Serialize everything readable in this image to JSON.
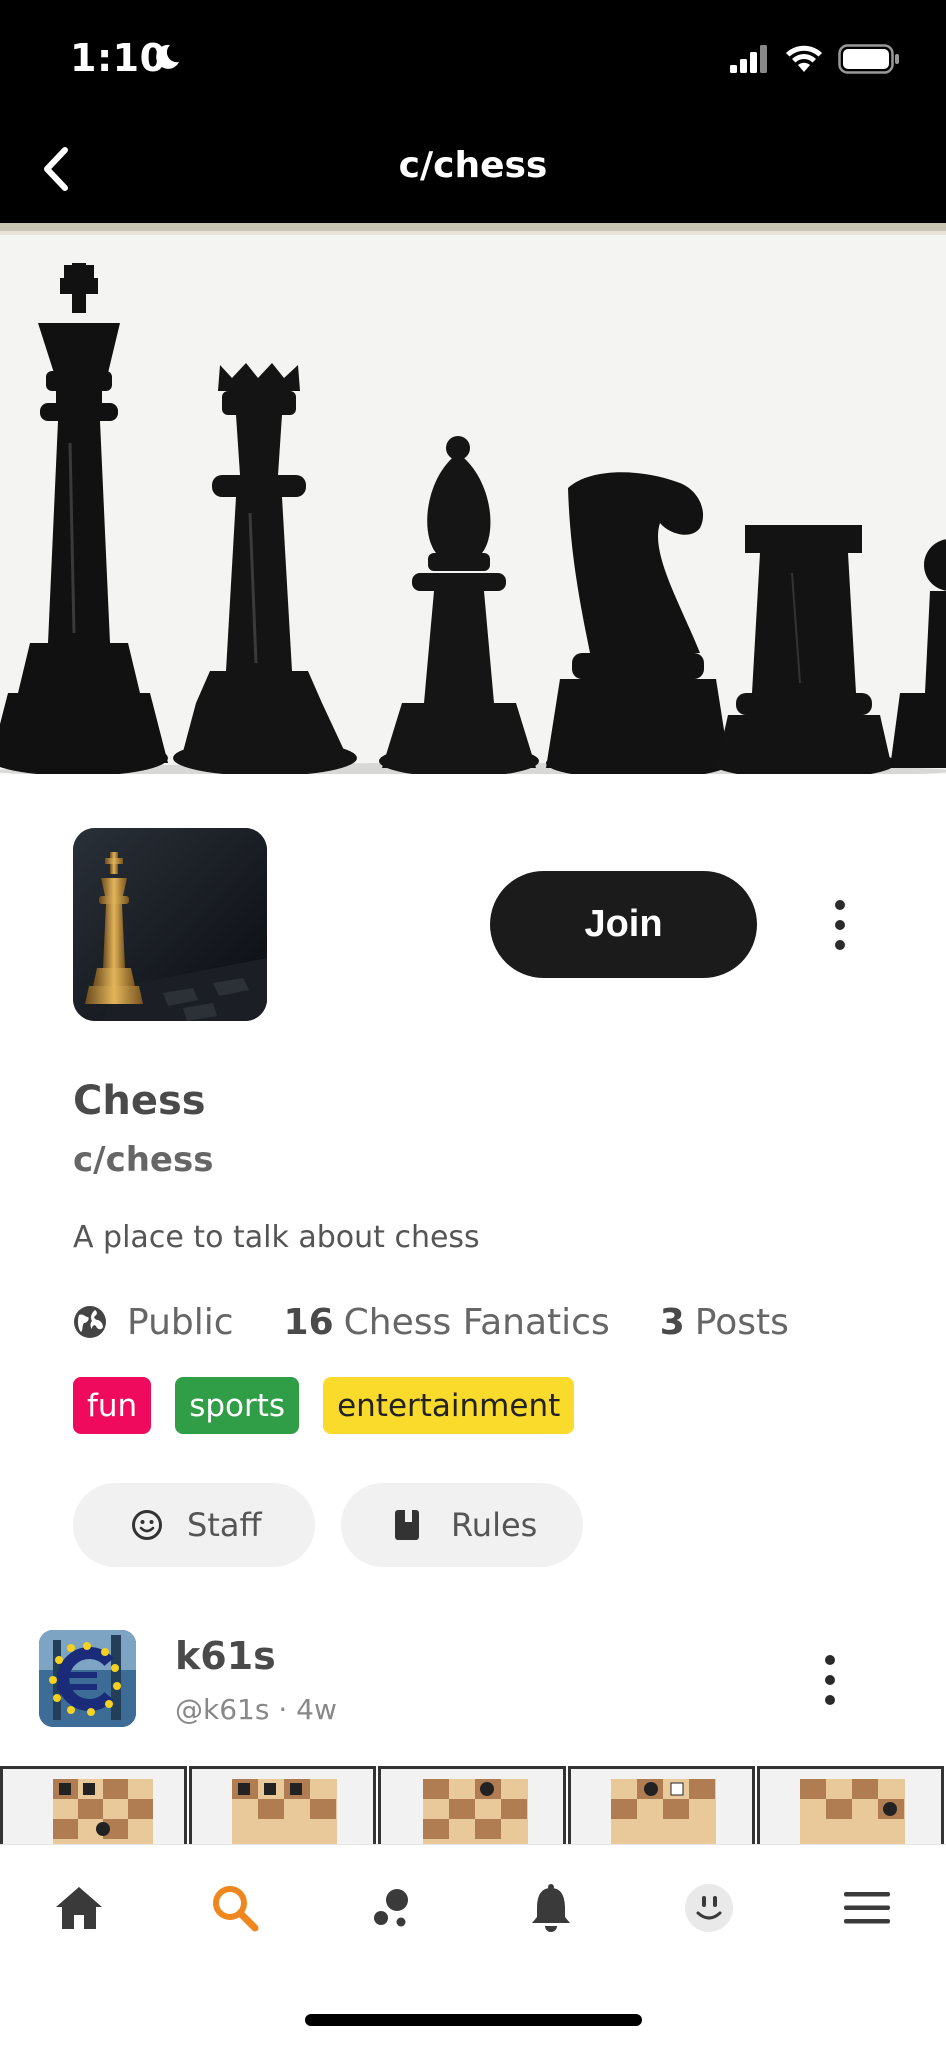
{
  "status_bar": {
    "time": "1:10"
  },
  "header": {
    "title": "c/chess"
  },
  "community": {
    "name": "Chess",
    "handle": "c/chess",
    "description": "A place to talk about chess",
    "join_label": "Join",
    "visibility": "Public",
    "member_count": "16",
    "member_label": "Chess Fanatics",
    "post_count": "3",
    "post_label": "Posts",
    "tags": [
      "fun",
      "sports",
      "entertainment"
    ],
    "staff_label": "Staff",
    "rules_label": "Rules"
  },
  "post": {
    "username": "k61s",
    "meta": "@k61s · 4w"
  },
  "nav": {
    "items": [
      "home-icon",
      "search-icon",
      "discover-icon",
      "bell-icon",
      "profile-icon",
      "menu-icon"
    ],
    "active": "search-icon",
    "active_color": "#f0861e"
  },
  "colors": {
    "tag_fun": "#ef0a5e",
    "tag_sports": "#2f9e47",
    "tag_entertainment": "#fadb2b",
    "join_button": "#1b1b1b"
  }
}
